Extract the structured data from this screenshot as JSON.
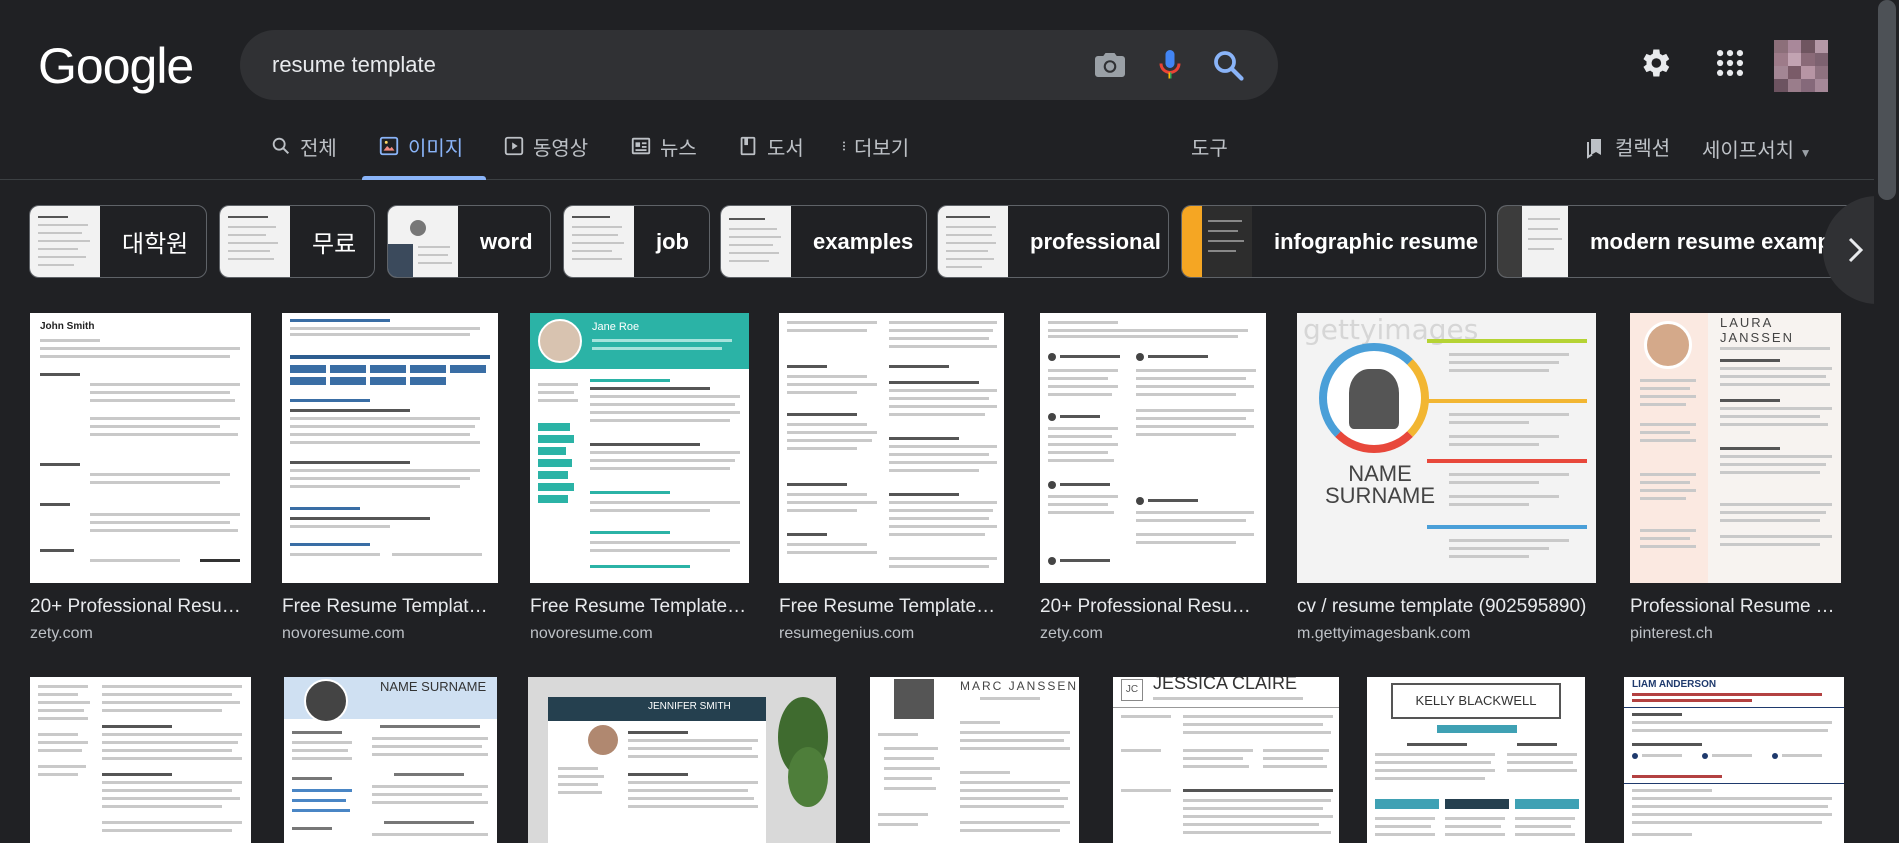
{
  "logo": "Google",
  "search": {
    "query": "resume template"
  },
  "tabs": [
    {
      "label": "전체",
      "icon": "search-icon"
    },
    {
      "label": "이미지",
      "icon": "image-icon"
    },
    {
      "label": "동영상",
      "icon": "play-icon"
    },
    {
      "label": "뉴스",
      "icon": "news-icon"
    },
    {
      "label": "도서",
      "icon": "book-icon"
    },
    {
      "label": "더보기",
      "icon": "more-vert-icon"
    }
  ],
  "tools_label": "도구",
  "collections_label": "컬렉션",
  "safesearch_label": "세이프서치",
  "chips": [
    {
      "label": "대학원"
    },
    {
      "label": "무료"
    },
    {
      "label": "word"
    },
    {
      "label": "job"
    },
    {
      "label": "examples"
    },
    {
      "label": "professional"
    },
    {
      "label": "infographic resume"
    },
    {
      "label": "modern resume example"
    }
  ],
  "results": [
    {
      "title": "20+ Professional Resume...",
      "source": "zety.com",
      "thumb_text": "John Smith"
    },
    {
      "title": "Free Resume Templates ...",
      "source": "novoresume.com",
      "thumb_text": ""
    },
    {
      "title": "Free Resume Templates ...",
      "source": "novoresume.com",
      "thumb_text": "Jane Roe"
    },
    {
      "title": "Free Resume Templates ...",
      "source": "resumegenius.com",
      "thumb_text": ""
    },
    {
      "title": "20+ Professional Resume...",
      "source": "zety.com",
      "thumb_text": ""
    },
    {
      "title": "cv / resume template (902595890)",
      "source": "m.gettyimagesbank.com",
      "thumb_text": "NAME SURNAME"
    },
    {
      "title": "Professional Resume Templates",
      "source": "pinterest.ch",
      "thumb_text": "LAURA JANSSEN"
    }
  ],
  "results_row2": [
    {
      "thumb_text": ""
    },
    {
      "thumb_text": "NAME SURNAME"
    },
    {
      "thumb_text": "JENNIFER SMITH"
    },
    {
      "thumb_text": "MARC JANSSEN"
    },
    {
      "thumb_text": "JESSICA CLAIRE"
    },
    {
      "thumb_text": "KELLY BLACKWELL"
    },
    {
      "thumb_text": "LIAM ANDERSON"
    }
  ],
  "colors": {
    "background": "#202124",
    "accent": "#8ab4f8",
    "search_box": "#303134"
  }
}
